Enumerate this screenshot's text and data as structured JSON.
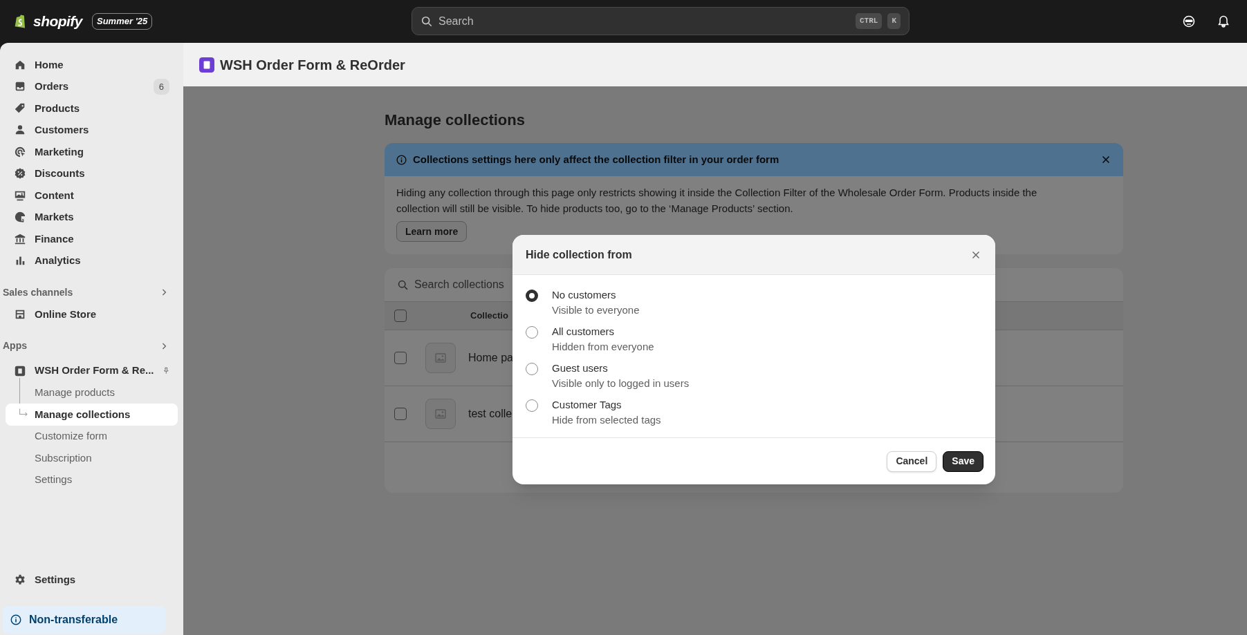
{
  "topbar": {
    "logo_text": "shopify",
    "edition_badge": "Summer '25",
    "search": {
      "placeholder": "Search"
    },
    "shortcut_keys": [
      "CTRL",
      "K"
    ]
  },
  "sidebar": {
    "items": [
      {
        "label": "Home",
        "selected": false
      },
      {
        "label": "Orders",
        "badge": "6",
        "selected": false
      },
      {
        "label": "Products",
        "selected": false
      },
      {
        "label": "Customers",
        "selected": false
      },
      {
        "label": "Marketing",
        "selected": false
      },
      {
        "label": "Discounts",
        "selected": false
      },
      {
        "label": "Content",
        "selected": false
      },
      {
        "label": "Markets",
        "selected": false
      },
      {
        "label": "Finance",
        "selected": false
      },
      {
        "label": "Analytics",
        "selected": false
      }
    ],
    "sales_channels": {
      "heading": "Sales channels",
      "items": [
        {
          "label": "Online Store",
          "selected": false
        }
      ]
    },
    "apps": {
      "heading": "Apps",
      "app": {
        "label": "WSH Order Form & Re...",
        "pinned": true
      },
      "children": [
        {
          "label": "Manage products",
          "selected": false
        },
        {
          "label": "Manage collections",
          "selected": true
        },
        {
          "label": "Customize form",
          "selected": false
        },
        {
          "label": "Subscription",
          "selected": false
        },
        {
          "label": "Settings",
          "selected": false
        }
      ]
    },
    "settings": {
      "label": "Settings"
    },
    "notice": {
      "label": "Non-transferable"
    }
  },
  "app_header": {
    "title": "WSH Order Form & ReOrder"
  },
  "page": {
    "title": "Manage collections",
    "banner": {
      "title": "Collections settings here only affect the collection filter in your order form",
      "body": "Hiding any collection through this page only restricts showing it inside the Collection Filter of the Wholesale Order Form. Products inside the collection will still be visible. To hide products too, go to the ‘Manage Products’ section.",
      "button": "Learn more"
    },
    "table": {
      "search": {
        "placeholder": "Search collections"
      },
      "select_all": {
        "checked": false
      },
      "column_1": "Collectio",
      "rows": [
        {
          "name": "Home pa",
          "checked": false
        },
        {
          "name": "test colle",
          "checked": false
        }
      ]
    }
  },
  "modal": {
    "title": "Hide collection from",
    "options": [
      {
        "label": "No customers",
        "description": "Visible to everyone",
        "selected": true
      },
      {
        "label": "All customers",
        "description": "Hidden from everyone",
        "selected": false
      },
      {
        "label": "Guest users",
        "description": "Visible only to logged in users",
        "selected": false
      },
      {
        "label": "Customer Tags",
        "description": "Hide from selected tags",
        "selected": false
      }
    ],
    "buttons": {
      "cancel": "Cancel",
      "save": "Save"
    }
  }
}
